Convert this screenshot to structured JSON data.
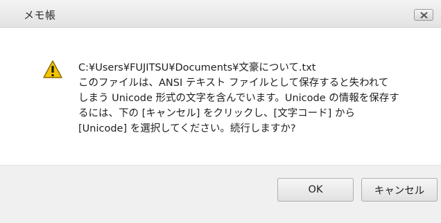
{
  "window": {
    "title": "メモ帳"
  },
  "dialog": {
    "icon": "warning-icon",
    "message": "C:¥Users¥FUJITSU¥Documents¥文豪について.txt\n このファイルは、ANSI テキスト ファイルとして保存すると失われて\nしまう Unicode 形式の文字を含んでいます。Unicode の情報を保存す\nるには、下の [キャンセル] をクリックし、[文字コード] から\n[Unicode] を選択してください。続行しますか?"
  },
  "buttons": {
    "ok_label": "OK",
    "cancel_label": "キャンセル"
  },
  "colors": {
    "warning_fill": "#f5c400",
    "warning_stroke": "#8a6d00"
  }
}
